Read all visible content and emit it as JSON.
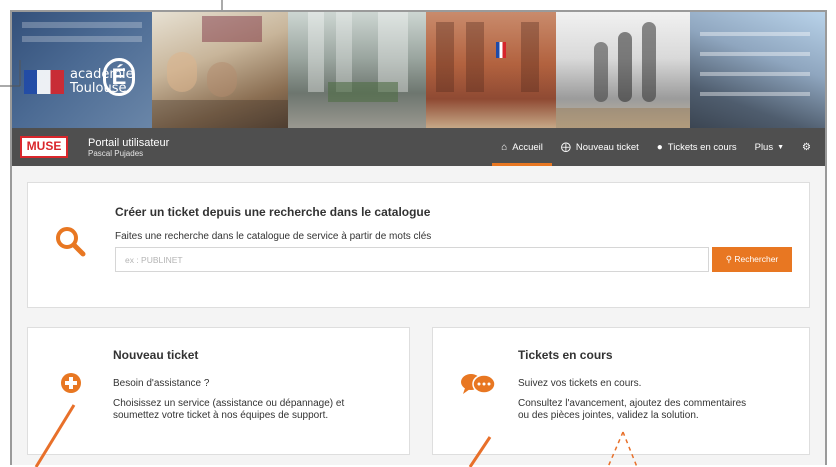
{
  "banner": {
    "logo_line1": "académie",
    "logo_line2": "Toulouse",
    "logo_letter": "É"
  },
  "navbar": {
    "logo_text": "MUSE",
    "title": "Portail utilisateur",
    "user": "Pascal Pujades",
    "items": [
      {
        "label": "Accueil",
        "icon": "home-icon",
        "active": true
      },
      {
        "label": "Nouveau ticket",
        "icon": "plus-circle-icon",
        "active": false
      },
      {
        "label": "Tickets en cours",
        "icon": "comments-icon",
        "active": false
      },
      {
        "label": "Plus",
        "icon": "chevron-down-icon",
        "active": false
      },
      {
        "label": "",
        "icon": "settings-cogs-icon",
        "active": false
      }
    ]
  },
  "search": {
    "title": "Créer un ticket depuis une recherche dans le catalogue",
    "subtitle": "Faites une recherche dans le catalogue de service à partir de mots clés",
    "placeholder": "ex : PUBLINET",
    "button_label": "Rechercher"
  },
  "new_ticket": {
    "title": "Nouveau ticket",
    "line1": "Besoin d'assistance ?",
    "line2": "Choisissez un service (assistance ou dépannage) et",
    "line3": "soumettez votre ticket à nos équipes de support."
  },
  "tickets_en_cours": {
    "title": "Tickets en cours",
    "line1": "Suivez vos tickets en cours.",
    "line2": "Consultez l'avancement, ajoutez des commentaires",
    "line3": "ou des pièces jointes, validez la solution."
  },
  "colors": {
    "accent": "#e87722",
    "navbar": "#4f4f4f",
    "background": "#f4f4f4"
  }
}
